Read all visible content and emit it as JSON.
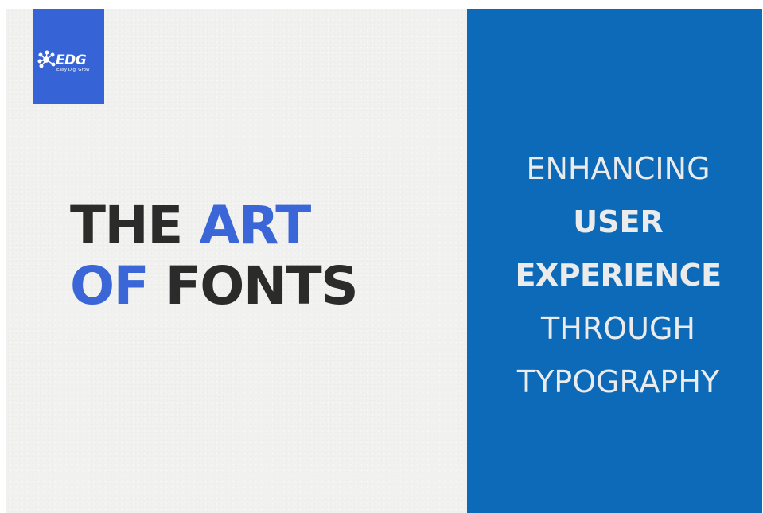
{
  "logo": {
    "mark": "EDG",
    "tagline": "Easy Digi Grow"
  },
  "headline": {
    "line1_part1": "THE ",
    "line1_part2": "ART",
    "line2_part1": "OF ",
    "line2_part2": "FONTS"
  },
  "panel": {
    "line1": "ENHANCING",
    "line2": "USER",
    "line3": "EXPERIENCE",
    "line4": "THROUGH",
    "line5": "TYPOGRAPHY"
  },
  "colors": {
    "logo_bg": "#3663d6",
    "panel_bg": "#0d6ab8",
    "headline_dark": "#2b2b2b",
    "headline_blue": "#3a66d8",
    "background": "#f1f1f0"
  }
}
